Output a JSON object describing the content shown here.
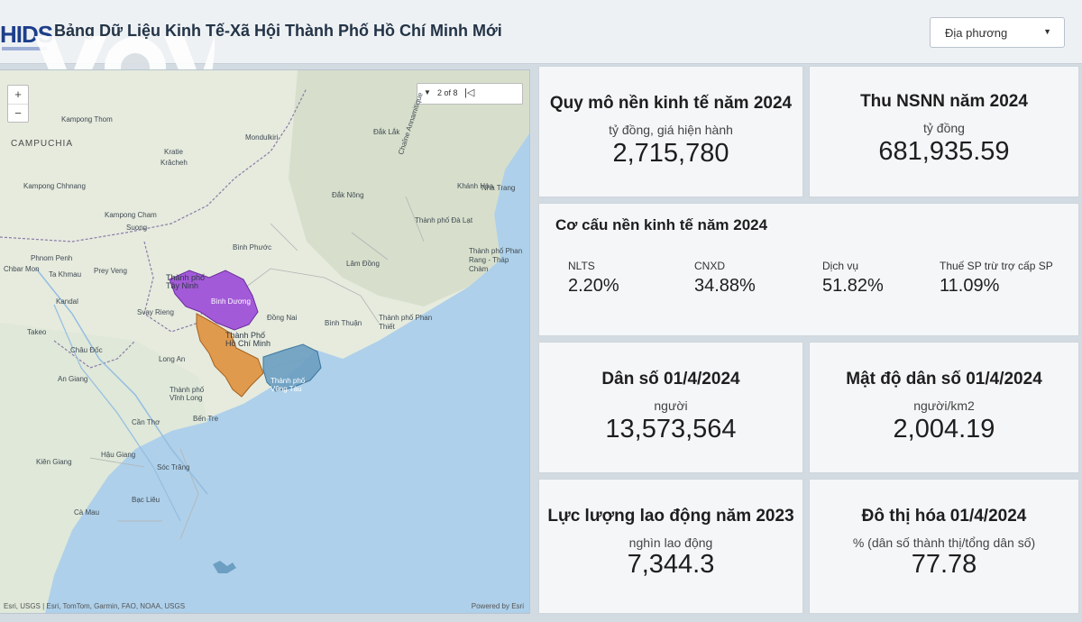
{
  "header": {
    "logo_text": "HIDS",
    "title": "Bảng Dữ Liệu Kinh Tế-Xã Hội Thành Phố Hồ Chí Minh Mới",
    "watermark": "VOV",
    "dropdown_value": "Địa phương"
  },
  "map": {
    "zoom_in": "+",
    "zoom_out": "−",
    "pager_text": "2 of 8",
    "attribution": "Esri, USGS | Esri, TomTom, Garmin, FAO, NOAA, USGS",
    "powered_by": "Powered by Esri",
    "labels": {
      "campuchia": "CAMPUCHIA",
      "kampong_thom": "Kampong Thom",
      "kratie": "Kratie",
      "krácheh": "Krâcheh",
      "mondulkiri": "Mondulkiri",
      "dak_lak": "Đắk Lắk",
      "dak_nong": "Đắk Nông",
      "kampong_chhnang": "Kampong Chhnang",
      "kampong_cham": "Kampong Cham",
      "suong": "Suong",
      "phnom_penh": "Phnom Penh",
      "ta_khmau": "Ta Khmau",
      "prey_veng": "Prey Veng",
      "chbar_mon": "Chbar Mon",
      "kandal": "Kandal",
      "svay_rieng": "Svay Rieng",
      "takeo": "Takeo",
      "binh_phuoc": "Bình Phước",
      "tay_ninh": "Thành phố Tây Ninh",
      "binh_duong": "Bình Dương",
      "dong_nai": "Đồng Nai",
      "hcm": "Thành Phố Hồ Chí Minh",
      "vung_tau": "Thành phố Vũng Tàu",
      "binh_thuan": "Bình Thuận",
      "phan_thiet": "Thành phố Phan Thiết",
      "lam_dong": "Lâm Đồng",
      "da_lat": "Thành phố Đà Lạt",
      "phan_rang": "Thành phố Phan Rang - Tháp Chàm",
      "nha_trang": "Nha Trang",
      "khanh_hoa": "Khánh Hòa",
      "chau_doc": "Châu Đốc",
      "long_an": "Long An",
      "an_giang": "An Giang",
      "vinh_long": "Thành phố Vĩnh Long",
      "can_tho": "Cần Thơ",
      "ben_tre": "Bến Tre",
      "kien_giang": "Kiên Giang",
      "hau_giang": "Hậu Giang",
      "soc_trang": "Sóc Trăng",
      "bac_lieu": "Bạc Liêu",
      "ca_mau": "Cà Mau",
      "chaine": "Chaîne Annamitique"
    }
  },
  "cards": {
    "gdp": {
      "title": "Quy mô nền kinh tế năm 2024",
      "unit": "tỷ đồng, giá hiện hành",
      "value": "2,715,780"
    },
    "budget": {
      "title": "Thu NSNN năm 2024",
      "unit": "tỷ đồng",
      "value": "681,935.59"
    },
    "structure": {
      "title": "Cơ cấu nền kinh tế năm 2024",
      "items": [
        {
          "label": "NLTS",
          "value": "2.20%"
        },
        {
          "label": "CNXD",
          "value": "34.88%"
        },
        {
          "label": "Dịch vụ",
          "value": "51.82%"
        },
        {
          "label": "Thuế SP trừ trợ cấp SP",
          "value": "11.09%"
        }
      ]
    },
    "population": {
      "title": "Dân số 01/4/2024",
      "unit": "người",
      "value": "13,573,564"
    },
    "density": {
      "title": "Mật độ dân số 01/4/2024",
      "unit": "người/km2",
      "value": "2,004.19"
    },
    "labor": {
      "title": "Lực lượng lao động năm 2023",
      "unit": "nghìn lao động",
      "value": "7,344.3"
    },
    "urban": {
      "title": "Đô thị hóa 01/4/2024",
      "unit": "% (dân số thành thị/tổng dân số)",
      "value": "77.78"
    }
  },
  "colors": {
    "binh_duong": "#a35ad9",
    "hcm": "#e09a4e",
    "vung_tau": "#6c9fc2",
    "sea": "#aed0ea",
    "land": "#e6ebde"
  }
}
